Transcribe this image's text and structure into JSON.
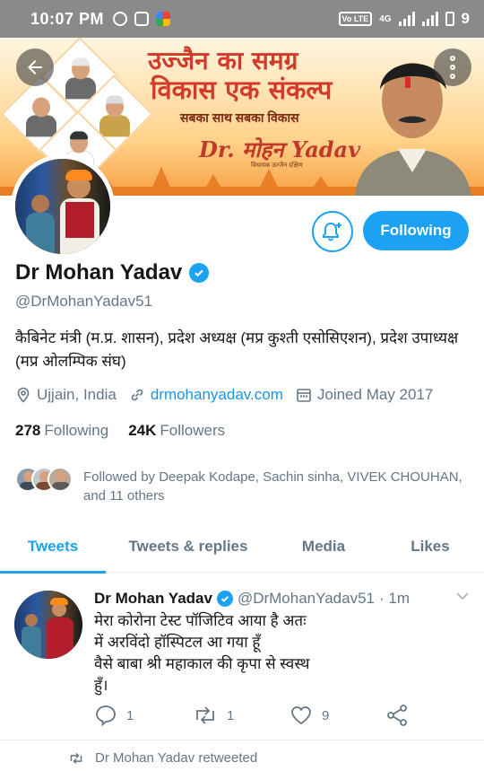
{
  "status_bar": {
    "time": "10:07 PM",
    "network_badge": "Vo LTE",
    "net_type": "4G",
    "battery_level": "9"
  },
  "banner": {
    "title_line1": "उज्जैन का समग्र",
    "title_line2": "विकास एक संकल्प",
    "tagline": "सबका साथ सबका विकास",
    "signature": "Dr. मोहन Yadav",
    "signature_caption": "विधायक उज्जैन दक्षिण"
  },
  "profile": {
    "name": "Dr Mohan Yadav",
    "handle": "@DrMohanYadav51",
    "bio": "कैबिनेट मंत्री (म.प्र. शासन), प्रदेश अध्यक्ष (मप्र कुश्ती एसोसिएशन), प्रदेश उपाध्यक्ष (मप्र ओलम्पिक संघ)",
    "location": "Ujjain, India",
    "website": "drmohanyadav.com",
    "joined": "Joined May 2017",
    "following_count": "278",
    "following_label": "Following",
    "followers_count": "24K",
    "followers_label": "Followers",
    "followed_by": "Followed by Deepak Kodape, Sachin sinha, VIVEK CHOUHAN, and 11 others",
    "follow_button": "Following"
  },
  "tabs": [
    {
      "label": "Tweets",
      "active": true
    },
    {
      "label": "Tweets & replies",
      "active": false
    },
    {
      "label": "Media",
      "active": false
    },
    {
      "label": "Likes",
      "active": false
    }
  ],
  "tweet": {
    "author": "Dr Mohan Yadav",
    "handle": "@DrMohanYadav51",
    "time": "· 1m",
    "text": "मेरा कोरोना टेस्ट पॉजिटिव आया है अतः\nमें अरविंदो हॉस्पिटल आ गया हूँ\nवैसे बाबा श्री महाकाल की कृपा से स्वस्थ\nहुँ।",
    "replies": "1",
    "retweets": "1",
    "likes": "9"
  },
  "next_item": {
    "retweeted_label": "Dr Mohan Yadav retweeted"
  },
  "colors": {
    "accent": "#1da1f2",
    "secondary_text": "#657786",
    "status_bar": "#8a8a8a"
  },
  "icons": [
    "back-arrow-icon",
    "more-options-icon",
    "notification-bell-icon",
    "verified-badge-icon",
    "location-pin-icon",
    "link-icon",
    "calendar-icon",
    "reply-icon",
    "retweet-icon",
    "like-heart-icon",
    "share-icon",
    "chevron-down-icon"
  ]
}
